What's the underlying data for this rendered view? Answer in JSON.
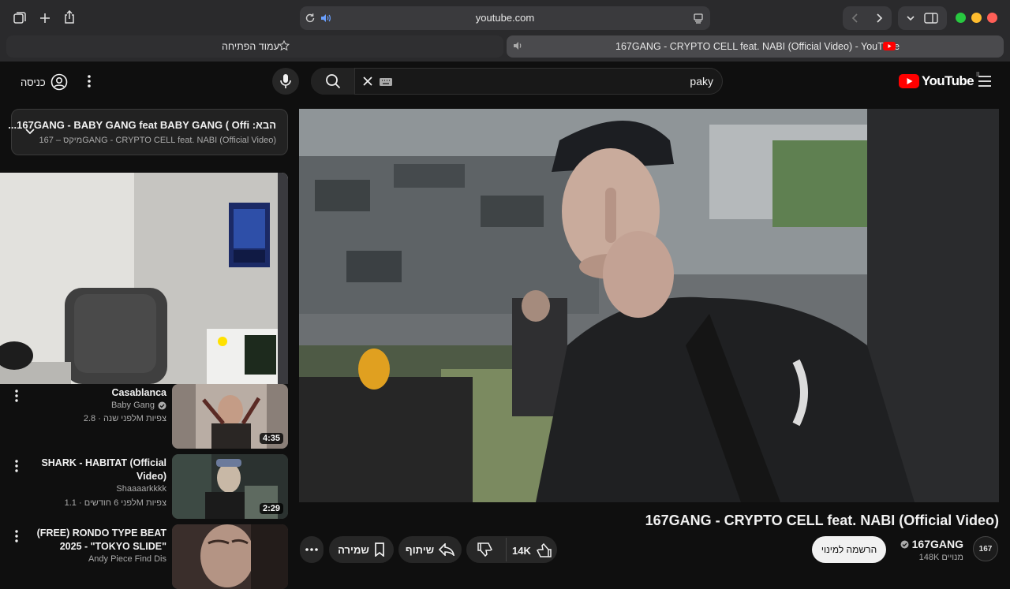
{
  "browser": {
    "url": "youtube.com",
    "tabs": [
      {
        "label": "עמוד הפתיחה"
      },
      {
        "label": "167GANG - CRYPTO CELL feat. NABI (Official Video) - YouTube"
      }
    ],
    "colors": {
      "close": "#ff5f57",
      "minimize": "#febc2e",
      "zoom": "#28c840"
    }
  },
  "header": {
    "logo_text": "YouTube",
    "region": "IL",
    "search_query": "paky",
    "signin_label": "כניסה",
    "brand_red": "#ff0000"
  },
  "queue": {
    "next_title": "הבא: 167GANG - BABY GANG feat BABY GANG ( Offi...",
    "mix_subtitle": "מיקס – 167GANG - CRYPTO CELL feat. NABI (Official Video)"
  },
  "recommendations": [
    {
      "title": "Casablanca",
      "channel": "Baby Gang",
      "verified": true,
      "views": "2.8M צפיות",
      "age": "לפני שנה",
      "duration": "4:35"
    },
    {
      "title": "SHARK - HABITAT (Official Video)",
      "channel": "Shaaaarkkkk",
      "verified": false,
      "views": "1.1M צפיות",
      "age": "לפני 6 חודשים",
      "duration": "2:29"
    },
    {
      "title": "(FREE) RONDO TYPE BEAT 2025 - \"TOKYO SLIDE\"",
      "channel": "Andy Piece Find Dis",
      "verified": false,
      "views": "",
      "age": "",
      "duration": ""
    }
  ],
  "video": {
    "title": "167GANG - CRYPTO CELL feat. NABI (Official Video)",
    "channel": "167GANG",
    "channel_avatar_text": "167",
    "subscribers": "148K מנויים",
    "subscribe_label": "הרשמה למינוי",
    "likes": "14K",
    "share_label": "שיתוף",
    "save_label": "שמירה"
  }
}
